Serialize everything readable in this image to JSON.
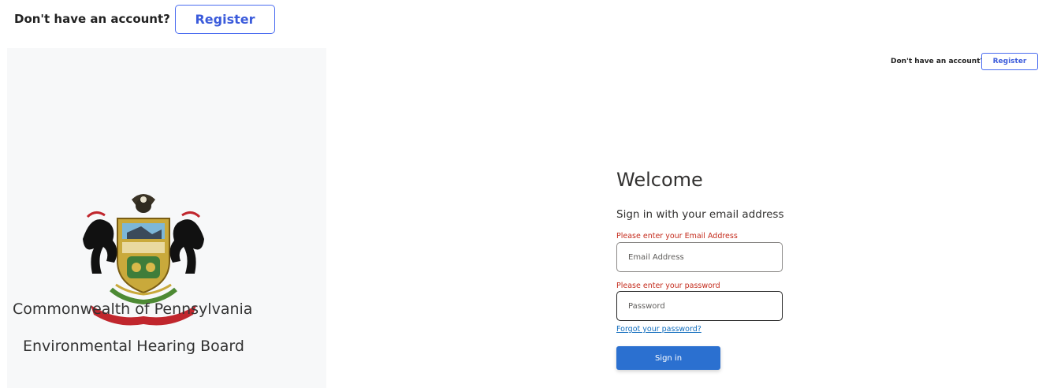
{
  "top_bar": {
    "prompt": "Don't have an account?",
    "register_label": "Register"
  },
  "left_panel": {
    "org_name": "Commonwealth of Pennsylvania",
    "board_name": "Environmental Hearing Board",
    "logo_icon": "pennsylvania-coat-of-arms"
  },
  "corner": {
    "prompt": "Don't have an account?",
    "register_label": "Register"
  },
  "form": {
    "title": "Welcome",
    "subtitle": "Sign in with your email address",
    "email": {
      "error": "Please enter your Email Address",
      "placeholder": "Email Address",
      "value": ""
    },
    "password": {
      "error": "Please enter your password",
      "placeholder": "Password",
      "value": ""
    },
    "forgot_label": "Forgot your password?",
    "signin_label": "Sign in"
  },
  "colors": {
    "accent": "#2b70d0",
    "register_border": "#4a6cf0",
    "error": "#c42b1c",
    "link": "#0f6cbd",
    "panel_bg": "#f7f8f9"
  }
}
